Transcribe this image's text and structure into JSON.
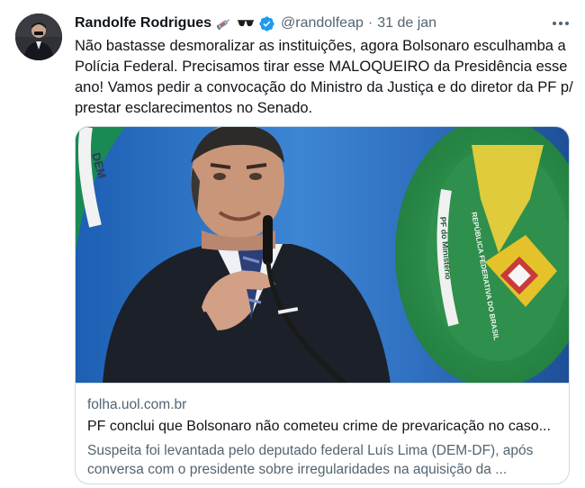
{
  "tweet": {
    "author_name": "Randolfe Rodrigues",
    "handle": "@randolfeap",
    "separator": "·",
    "date": "31 de jan",
    "name_emojis": [
      "syringe-icon",
      "sunglasses-icon"
    ],
    "verified": true,
    "text_lines": [
      "Não bastasse desmoralizar as instituições, agora Bolsonaro esculhamba a",
      "Polícia Federal. Precisamos tirar esse MALOQUEIRO da Presidência esse",
      "ano! Vamos pedir a convocação do Ministro da Justiça e do diretor da PF p/",
      "prestar esclarecimentos no Senado."
    ]
  },
  "card": {
    "domain": "folha.uol.com.br",
    "title": "PF conclui que Bolsonaro não cometeu crime de prevaricação no caso...",
    "description_lines": [
      "Suspeita foi levantada pelo deputado federal Luís Lima (DEM-DF), após",
      "conversa com o presidente sobre irregularidades na aquisição da ..."
    ],
    "image_banner_text": "REPÚBLICA FEDERATIVA DO BRASIL"
  },
  "colors": {
    "primary_text": "#0f1419",
    "secondary_text": "#536471",
    "verified_blue": "#1d9bf0",
    "border": "#cfd9de"
  }
}
